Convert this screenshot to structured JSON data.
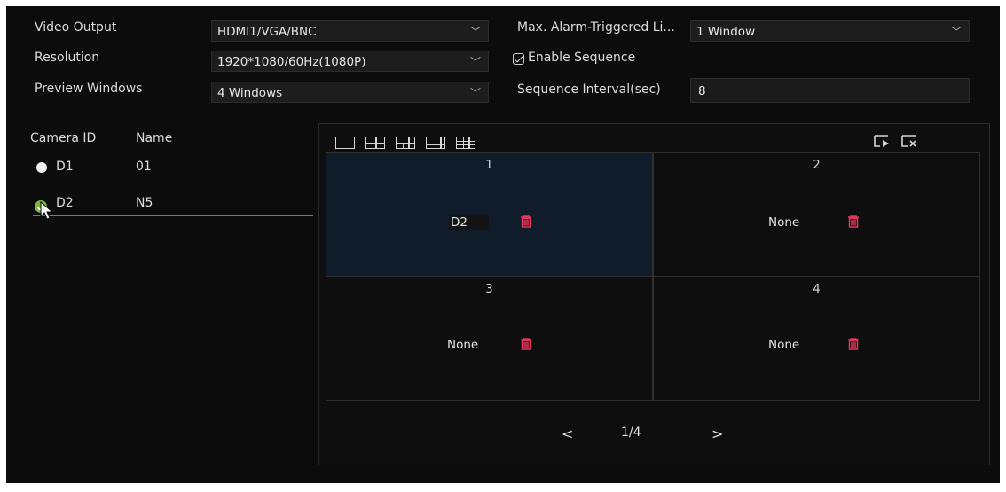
{
  "settings": {
    "video_output": {
      "label": "Video Output",
      "value": "HDMI1/VGA/BNC"
    },
    "resolution": {
      "label": "Resolution",
      "value": "1920*1080/60Hz(1080P)"
    },
    "preview_windows": {
      "label": "Preview Windows",
      "value": "4 Windows"
    },
    "max_alarm": {
      "label": "Max. Alarm-Triggered Li...",
      "value": "1 Window"
    },
    "enable_sequence": {
      "label": "Enable Sequence",
      "checked": true
    },
    "sequence_interval": {
      "label": "Sequence Interval(sec)",
      "value": "8"
    }
  },
  "camera_list": {
    "headers": {
      "id": "Camera ID",
      "name": "Name"
    },
    "rows": [
      {
        "id": "D1",
        "name": "01",
        "status": "idle"
      },
      {
        "id": "D2",
        "name": "N5",
        "status": "selected"
      }
    ]
  },
  "preview": {
    "panes": [
      {
        "number": "1",
        "camera": "D2"
      },
      {
        "number": "2",
        "camera": "None"
      },
      {
        "number": "3",
        "camera": "None"
      },
      {
        "number": "4",
        "camera": "None"
      }
    ],
    "pager": {
      "prev": "<",
      "page": "1/4",
      "next": ">"
    }
  },
  "icons": {
    "layout_1": "single-window-layout-icon",
    "layout_4": "four-window-layout-icon",
    "layout_6": "six-window-layout-icon",
    "layout_8": "eight-window-layout-icon",
    "layout_9": "nine-window-layout-icon",
    "play_sequence": "play-sequence-icon",
    "clear_all": "clear-all-icon",
    "delete": "trash-icon"
  },
  "colors": {
    "accent_line": "#4b7ad8",
    "delete_red": "#e0365a",
    "check_green": "#7bb53a",
    "background": "#0c0c0c"
  }
}
